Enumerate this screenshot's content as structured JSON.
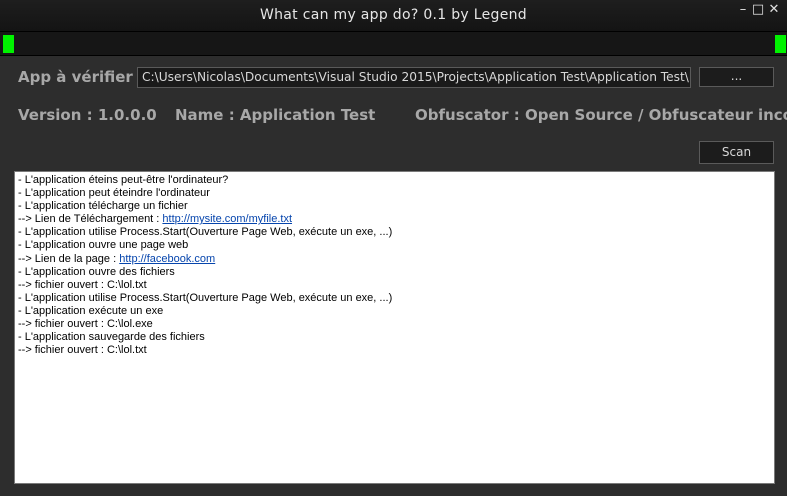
{
  "window": {
    "title": "What can my app do? 0.1 by Legend",
    "minimize_glyph": "–",
    "maximize_glyph": "□",
    "close_glyph": "✕"
  },
  "progress": {
    "color": "#00f200"
  },
  "app_field": {
    "label": "App à vérifier :",
    "value": "C:\\Users\\Nicolas\\Documents\\Visual Studio 2015\\Projects\\Application Test\\Application Test\\bin\\Debug\\Application Test.exe",
    "browse_label": "..."
  },
  "info": {
    "version": "Version : 1.0.0.0",
    "name": "Name : Application Test",
    "obfuscator": "Obfuscator : Open Source / Obfuscateur inconnu"
  },
  "scan_label": "Scan",
  "output_lines": [
    {
      "text": "- L'application éteins peut-être l'ordinateur?"
    },
    {
      "text": "- L'application peut éteindre l'ordinateur"
    },
    {
      "text": "- L'application télécharge un fichier"
    },
    {
      "text": "--> Lien de Téléchargement : ",
      "link": "http://mysite.com/myfile.txt"
    },
    {
      "text": "- L'application utilise Process.Start(Ouverture Page Web, exécute un exe, ...)"
    },
    {
      "text": "- L'application ouvre une page web"
    },
    {
      "text": "--> Lien de la page : ",
      "link": "http://facebook.com"
    },
    {
      "text": "- L'application ouvre des fichiers"
    },
    {
      "text": "--> fichier ouvert : C:\\lol.txt"
    },
    {
      "text": "- L'application utilise Process.Start(Ouverture Page Web, exécute un exe, ...)"
    },
    {
      "text": "- L'application exécute un exe"
    },
    {
      "text": "--> fichier ouvert : C:\\lol.exe"
    },
    {
      "text": "- L'application sauvegarde des fichiers"
    },
    {
      "text": "--> fichier ouvert : C:\\lol.txt"
    }
  ]
}
